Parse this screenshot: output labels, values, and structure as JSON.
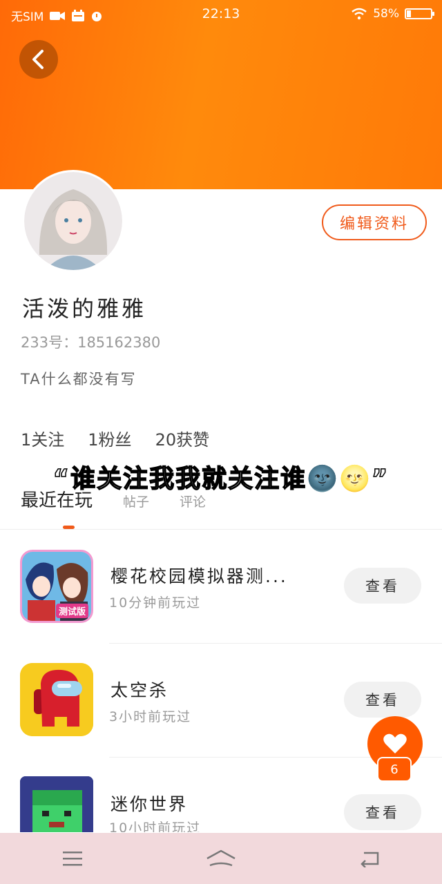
{
  "status_bar": {
    "sim": "无SIM",
    "time": "22:13",
    "battery": "58%"
  },
  "profile": {
    "name": "活泼的雅雅",
    "uid": "233号：185162380",
    "bio": "TA什么都没有写",
    "edit_label": "编辑资料",
    "stats": {
      "following": "1关注",
      "fans": "1粉丝",
      "likes": "20获赞"
    }
  },
  "caption": "“谁关注我我就关注谁🌚🌝”",
  "tabs": [
    {
      "label": "最近在玩"
    },
    {
      "label": "帖子"
    },
    {
      "label": "评论"
    }
  ],
  "games": [
    {
      "title": "樱花校园模拟器测...",
      "time": "10分钟前玩过",
      "action": "查看",
      "badge": "测试版"
    },
    {
      "title": "太空杀",
      "time": "3小时前玩过",
      "action": "查看"
    },
    {
      "title": "迷你世界",
      "time": "10小时前玩过",
      "action": "查看"
    }
  ],
  "like_count": "6",
  "icons": {
    "back": "chevron-left-icon",
    "like": "heart-icon",
    "nav": [
      "menu-icon",
      "home-icon",
      "back-icon"
    ]
  },
  "colors": {
    "accent": "#ff6a08",
    "edit_border": "#f05a1a",
    "navbar": "#f2d9dc"
  }
}
